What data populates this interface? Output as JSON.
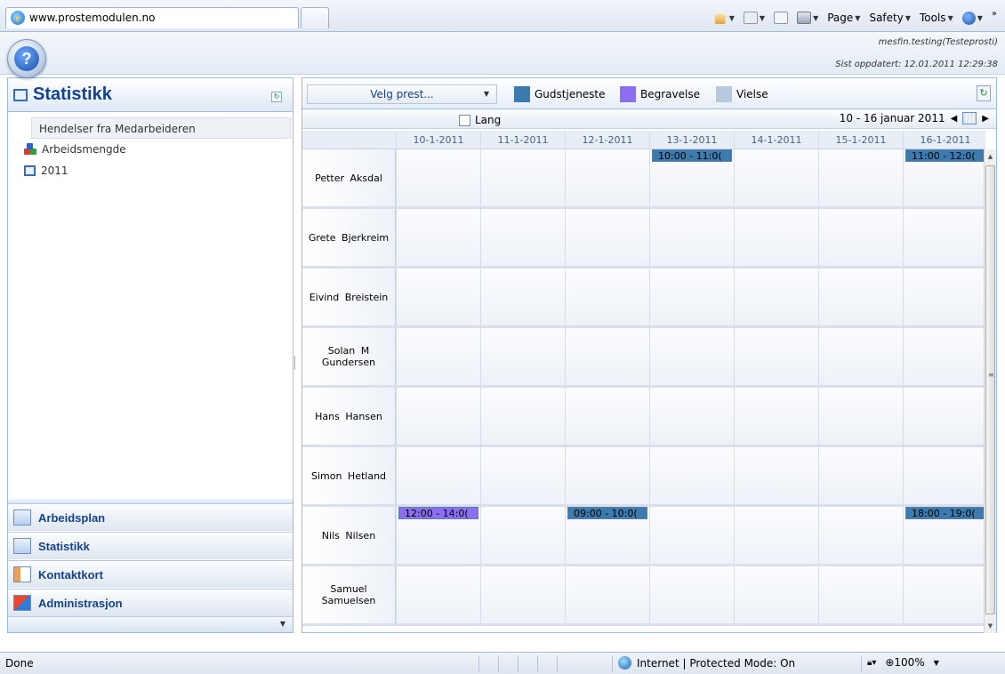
{
  "browser": {
    "tab_title": "www.prostemodulen.no",
    "commands": {
      "page": "Page",
      "safety": "Safety",
      "tools": "Tools"
    },
    "overflow": "»"
  },
  "header": {
    "user": "mesfin.testing(Testeprosti)",
    "last_updated": "Sist oppdatert: 12.01.2011 12:29:38"
  },
  "left": {
    "title": "Statistikk",
    "selected_item": "Hendelser fra Medarbeideren",
    "items": [
      {
        "label": "Arbeidsmengde",
        "icon": "cubes-icon"
      },
      {
        "label": "2011",
        "icon": "calendar-icon"
      }
    ],
    "nav": [
      {
        "label": "Arbeidsplan",
        "icon": "calendar-icon"
      },
      {
        "label": "Statistikk",
        "icon": "calendar-icon"
      },
      {
        "label": "Kontaktkort",
        "icon": "contact-card-icon"
      },
      {
        "label": "Administrasjon",
        "icon": "admin-icon"
      }
    ]
  },
  "right": {
    "select_label": "Velg prest...",
    "legend": [
      {
        "label": "Gudstjeneste",
        "color": "#3d7aad"
      },
      {
        "label": "Begravelse",
        "color": "#8c6ef2"
      },
      {
        "label": "Vielse",
        "color": "#b7c8df"
      }
    ],
    "lang_label": "Lang",
    "date_range": "10 - 16 januar 2011",
    "days": [
      "10-1-2011",
      "11-1-2011",
      "12-1-2011",
      "13-1-2011",
      "14-1-2011",
      "15-1-2011",
      "16-1-2011"
    ],
    "rows": [
      {
        "name": "Petter  Aksdal",
        "appointments": [
          {
            "day": 3,
            "label": "10:00 - 11:0(",
            "type": "Gudstjeneste"
          },
          {
            "day": 6,
            "label": "11:00 - 12:0(",
            "type": "Gudstjeneste"
          }
        ]
      },
      {
        "name": "Grete  Bjerkreim",
        "appointments": []
      },
      {
        "name": "Eivind  Breistein",
        "appointments": []
      },
      {
        "name": "Solan M Gundersen",
        "appointments": []
      },
      {
        "name": "Hans  Hansen",
        "appointments": []
      },
      {
        "name": "Simon  Hetland",
        "appointments": []
      },
      {
        "name": "Nils  Nilsen",
        "appointments": [
          {
            "day": 0,
            "label": "12:00 - 14:0(",
            "type": "Begravelse"
          },
          {
            "day": 2,
            "label": "09:00 - 10:0(",
            "type": "Gudstjeneste"
          },
          {
            "day": 6,
            "label": "18:00 - 19:0(",
            "type": "Gudstjeneste"
          }
        ]
      },
      {
        "name": "Samuel Samuelsen",
        "appointments": []
      }
    ]
  },
  "status": {
    "left": "Done",
    "zone": "Internet | Protected Mode: On",
    "zoom": "100%"
  }
}
